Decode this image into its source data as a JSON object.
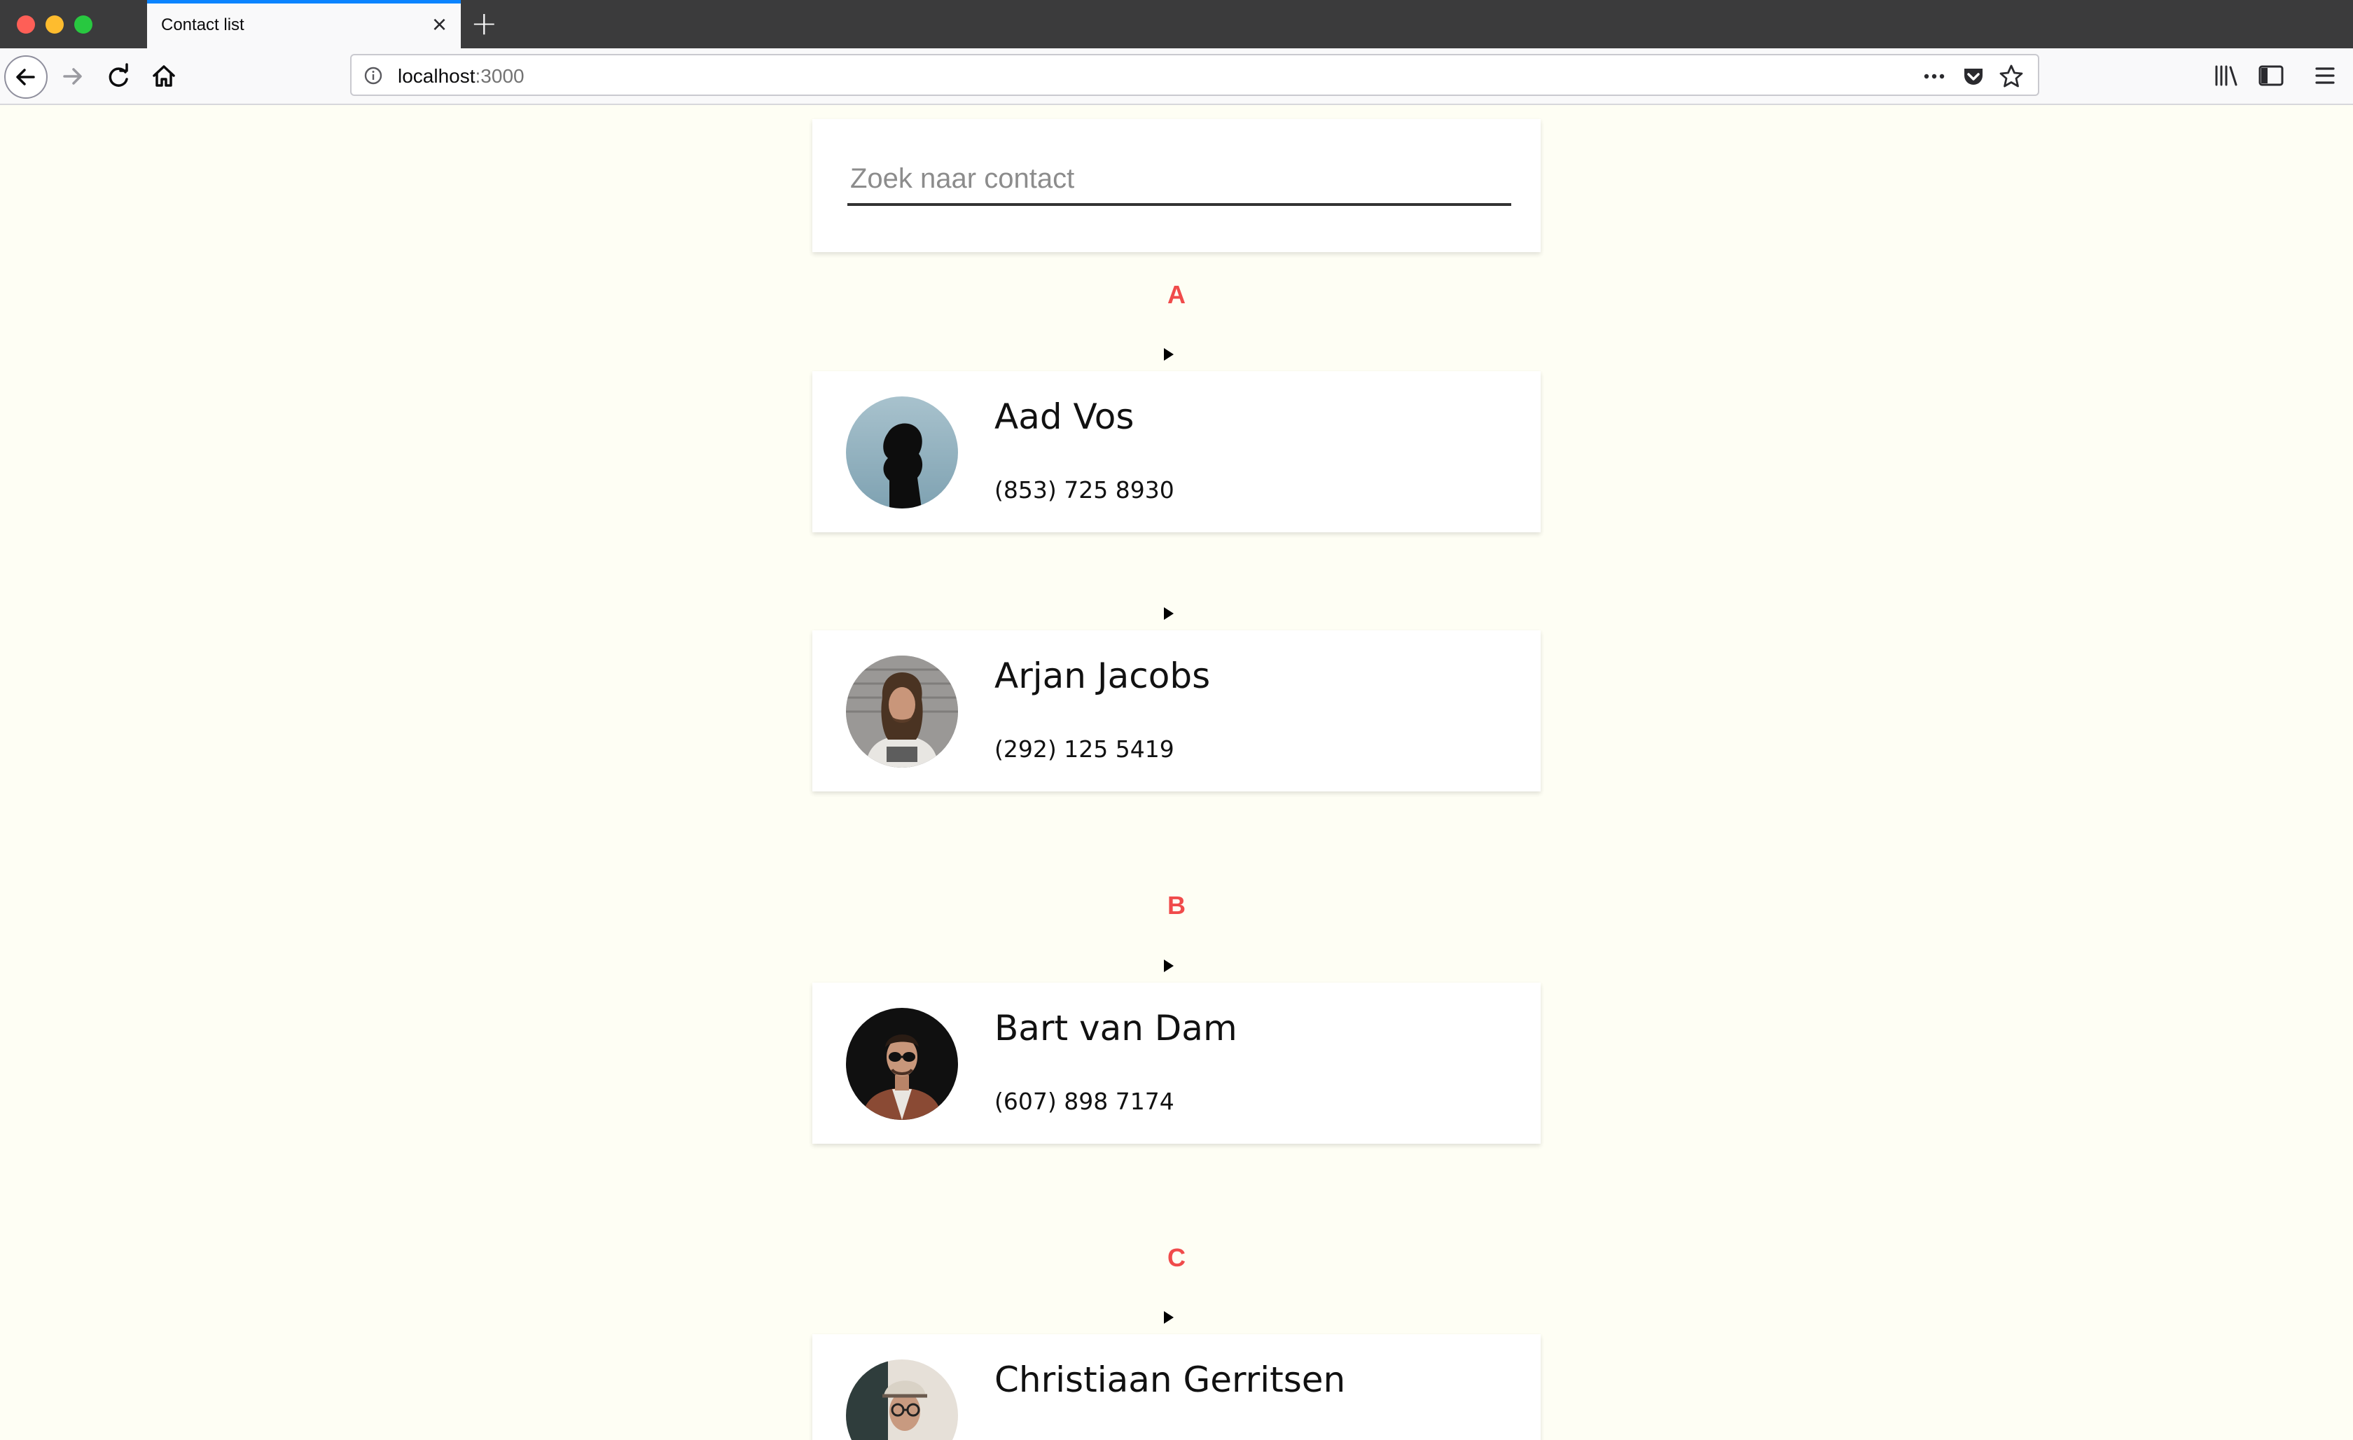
{
  "browser": {
    "tab_title": "Contact list",
    "url_host": "localhost",
    "url_port": ":3000"
  },
  "search": {
    "placeholder": "Zoek naar contact",
    "value": ""
  },
  "groups": [
    {
      "letter": "A",
      "contacts": [
        {
          "name": "Aad Vos",
          "phone": "(853) 725 8930",
          "avatar": "silhouette-portrait"
        },
        {
          "name": "Arjan Jacobs",
          "phone": "(292) 125 5419",
          "avatar": "long-hair-portrait"
        }
      ]
    },
    {
      "letter": "B",
      "contacts": [
        {
          "name": "Bart van Dam",
          "phone": "(607) 898 7174",
          "avatar": "sunglasses-portrait"
        }
      ]
    },
    {
      "letter": "C",
      "contacts": [
        {
          "name": "Christiaan Gerritsen",
          "phone": "",
          "avatar": "hat-glasses-portrait"
        }
      ]
    }
  ],
  "colors": {
    "page_background": "#fefef4",
    "group_letter": "#f04b4b",
    "tab_accent": "#0a84ff"
  }
}
